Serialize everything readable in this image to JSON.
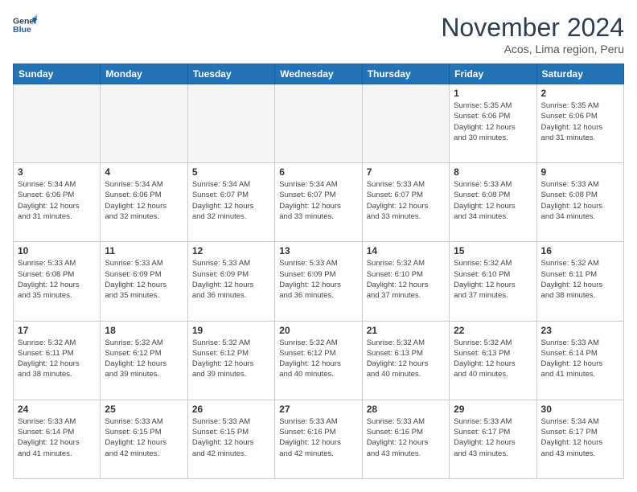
{
  "header": {
    "logo_line1": "General",
    "logo_line2": "Blue",
    "month_title": "November 2024",
    "location": "Acos, Lima region, Peru"
  },
  "days_of_week": [
    "Sunday",
    "Monday",
    "Tuesday",
    "Wednesday",
    "Thursday",
    "Friday",
    "Saturday"
  ],
  "weeks": [
    [
      {
        "day": "",
        "info": ""
      },
      {
        "day": "",
        "info": ""
      },
      {
        "day": "",
        "info": ""
      },
      {
        "day": "",
        "info": ""
      },
      {
        "day": "",
        "info": ""
      },
      {
        "day": "1",
        "info": "Sunrise: 5:35 AM\nSunset: 6:06 PM\nDaylight: 12 hours\nand 30 minutes."
      },
      {
        "day": "2",
        "info": "Sunrise: 5:35 AM\nSunset: 6:06 PM\nDaylight: 12 hours\nand 31 minutes."
      }
    ],
    [
      {
        "day": "3",
        "info": "Sunrise: 5:34 AM\nSunset: 6:06 PM\nDaylight: 12 hours\nand 31 minutes."
      },
      {
        "day": "4",
        "info": "Sunrise: 5:34 AM\nSunset: 6:06 PM\nDaylight: 12 hours\nand 32 minutes."
      },
      {
        "day": "5",
        "info": "Sunrise: 5:34 AM\nSunset: 6:07 PM\nDaylight: 12 hours\nand 32 minutes."
      },
      {
        "day": "6",
        "info": "Sunrise: 5:34 AM\nSunset: 6:07 PM\nDaylight: 12 hours\nand 33 minutes."
      },
      {
        "day": "7",
        "info": "Sunrise: 5:33 AM\nSunset: 6:07 PM\nDaylight: 12 hours\nand 33 minutes."
      },
      {
        "day": "8",
        "info": "Sunrise: 5:33 AM\nSunset: 6:08 PM\nDaylight: 12 hours\nand 34 minutes."
      },
      {
        "day": "9",
        "info": "Sunrise: 5:33 AM\nSunset: 6:08 PM\nDaylight: 12 hours\nand 34 minutes."
      }
    ],
    [
      {
        "day": "10",
        "info": "Sunrise: 5:33 AM\nSunset: 6:08 PM\nDaylight: 12 hours\nand 35 minutes."
      },
      {
        "day": "11",
        "info": "Sunrise: 5:33 AM\nSunset: 6:09 PM\nDaylight: 12 hours\nand 35 minutes."
      },
      {
        "day": "12",
        "info": "Sunrise: 5:33 AM\nSunset: 6:09 PM\nDaylight: 12 hours\nand 36 minutes."
      },
      {
        "day": "13",
        "info": "Sunrise: 5:33 AM\nSunset: 6:09 PM\nDaylight: 12 hours\nand 36 minutes."
      },
      {
        "day": "14",
        "info": "Sunrise: 5:32 AM\nSunset: 6:10 PM\nDaylight: 12 hours\nand 37 minutes."
      },
      {
        "day": "15",
        "info": "Sunrise: 5:32 AM\nSunset: 6:10 PM\nDaylight: 12 hours\nand 37 minutes."
      },
      {
        "day": "16",
        "info": "Sunrise: 5:32 AM\nSunset: 6:11 PM\nDaylight: 12 hours\nand 38 minutes."
      }
    ],
    [
      {
        "day": "17",
        "info": "Sunrise: 5:32 AM\nSunset: 6:11 PM\nDaylight: 12 hours\nand 38 minutes."
      },
      {
        "day": "18",
        "info": "Sunrise: 5:32 AM\nSunset: 6:12 PM\nDaylight: 12 hours\nand 39 minutes."
      },
      {
        "day": "19",
        "info": "Sunrise: 5:32 AM\nSunset: 6:12 PM\nDaylight: 12 hours\nand 39 minutes."
      },
      {
        "day": "20",
        "info": "Sunrise: 5:32 AM\nSunset: 6:12 PM\nDaylight: 12 hours\nand 40 minutes."
      },
      {
        "day": "21",
        "info": "Sunrise: 5:32 AM\nSunset: 6:13 PM\nDaylight: 12 hours\nand 40 minutes."
      },
      {
        "day": "22",
        "info": "Sunrise: 5:32 AM\nSunset: 6:13 PM\nDaylight: 12 hours\nand 40 minutes."
      },
      {
        "day": "23",
        "info": "Sunrise: 5:33 AM\nSunset: 6:14 PM\nDaylight: 12 hours\nand 41 minutes."
      }
    ],
    [
      {
        "day": "24",
        "info": "Sunrise: 5:33 AM\nSunset: 6:14 PM\nDaylight: 12 hours\nand 41 minutes."
      },
      {
        "day": "25",
        "info": "Sunrise: 5:33 AM\nSunset: 6:15 PM\nDaylight: 12 hours\nand 42 minutes."
      },
      {
        "day": "26",
        "info": "Sunrise: 5:33 AM\nSunset: 6:15 PM\nDaylight: 12 hours\nand 42 minutes."
      },
      {
        "day": "27",
        "info": "Sunrise: 5:33 AM\nSunset: 6:16 PM\nDaylight: 12 hours\nand 42 minutes."
      },
      {
        "day": "28",
        "info": "Sunrise: 5:33 AM\nSunset: 6:16 PM\nDaylight: 12 hours\nand 43 minutes."
      },
      {
        "day": "29",
        "info": "Sunrise: 5:33 AM\nSunset: 6:17 PM\nDaylight: 12 hours\nand 43 minutes."
      },
      {
        "day": "30",
        "info": "Sunrise: 5:34 AM\nSunset: 6:17 PM\nDaylight: 12 hours\nand 43 minutes."
      }
    ]
  ]
}
